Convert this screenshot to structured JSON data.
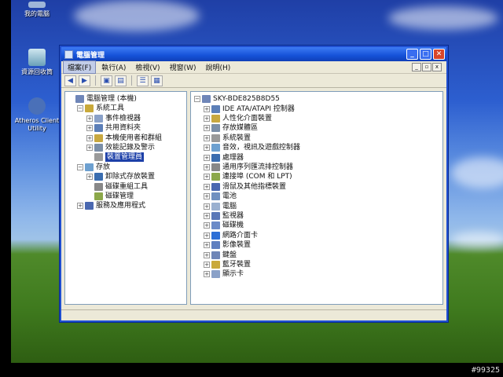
{
  "desktop": {
    "icons": [
      {
        "label": "我的電腦",
        "icon": "computer-icon"
      },
      {
        "label": "資源回收筒",
        "icon": "recycle-bin-icon"
      },
      {
        "label": "Atheros Client Utility",
        "icon": "atheros-icon"
      }
    ]
  },
  "window": {
    "title": "電腦管理",
    "minimize": "_",
    "maximize": "□",
    "close": "✕"
  },
  "menubar": {
    "items": [
      "檔案(F)",
      "執行(A)",
      "檢視(V)",
      "視窗(W)",
      "說明(H)"
    ],
    "mdi_minimize": "_",
    "mdi_restore": "▫",
    "mdi_close": "x"
  },
  "left_tree": [
    {
      "label": "電腦管理 (本機)",
      "level": 0,
      "expander": "",
      "icon": "computer-management-icon"
    },
    {
      "label": "系統工具",
      "level": 1,
      "expander": "−",
      "icon": "tools-icon"
    },
    {
      "label": "事件檢視器",
      "level": 2,
      "expander": "+",
      "icon": "event-viewer-icon"
    },
    {
      "label": "共用資料夾",
      "level": 2,
      "expander": "+",
      "icon": "shared-folder-icon"
    },
    {
      "label": "本機使用者和群組",
      "level": 2,
      "expander": "+",
      "icon": "users-icon"
    },
    {
      "label": "效能記錄及警示",
      "level": 2,
      "expander": "+",
      "icon": "performance-icon"
    },
    {
      "label": "裝置管理員",
      "level": 2,
      "expander": "",
      "icon": "device-manager-icon",
      "selected": true
    },
    {
      "label": "存放",
      "level": 1,
      "expander": "−",
      "icon": "storage-icon"
    },
    {
      "label": "卸除式存放裝置",
      "level": 2,
      "expander": "+",
      "icon": "removable-storage-icon"
    },
    {
      "label": "磁碟重組工具",
      "level": 2,
      "expander": "",
      "icon": "defrag-icon"
    },
    {
      "label": "磁碟管理",
      "level": 2,
      "expander": "",
      "icon": "disk-management-icon"
    },
    {
      "label": "服務及應用程式",
      "level": 1,
      "expander": "+",
      "icon": "services-icon"
    }
  ],
  "right_tree": {
    "root": "SKY-BDE825B8D55",
    "items": [
      {
        "label": "IDE ATA/ATAPI 控制器",
        "icon": "ide-controller-icon"
      },
      {
        "label": "人性化介面裝置",
        "icon": "hid-icon"
      },
      {
        "label": "存放媒體區",
        "icon": "storage-volume-icon"
      },
      {
        "label": "系統裝置",
        "icon": "system-device-icon"
      },
      {
        "label": "音效，視訊及遊戲控制器",
        "icon": "sound-icon"
      },
      {
        "label": "處理器",
        "icon": "processor-icon"
      },
      {
        "label": "通用序列匯流排控制器",
        "icon": "usb-icon"
      },
      {
        "label": "連接埠 (COM 和 LPT)",
        "icon": "port-icon"
      },
      {
        "label": "滑鼠及其他指標裝置",
        "icon": "mouse-icon"
      },
      {
        "label": "電池",
        "icon": "battery-icon"
      },
      {
        "label": "電腦",
        "icon": "computer-icon"
      },
      {
        "label": "監視器",
        "icon": "monitor-icon"
      },
      {
        "label": "磁碟機",
        "icon": "disk-drive-icon"
      },
      {
        "label": "網路介面卡",
        "icon": "network-adapter-icon"
      },
      {
        "label": "影像裝置",
        "icon": "imaging-icon"
      },
      {
        "label": "鍵盤",
        "icon": "keyboard-icon"
      },
      {
        "label": "藍牙裝置",
        "icon": "bluetooth-icon"
      },
      {
        "label": "顯示卡",
        "icon": "display-adapter-icon"
      }
    ]
  },
  "watermark": "#99325"
}
